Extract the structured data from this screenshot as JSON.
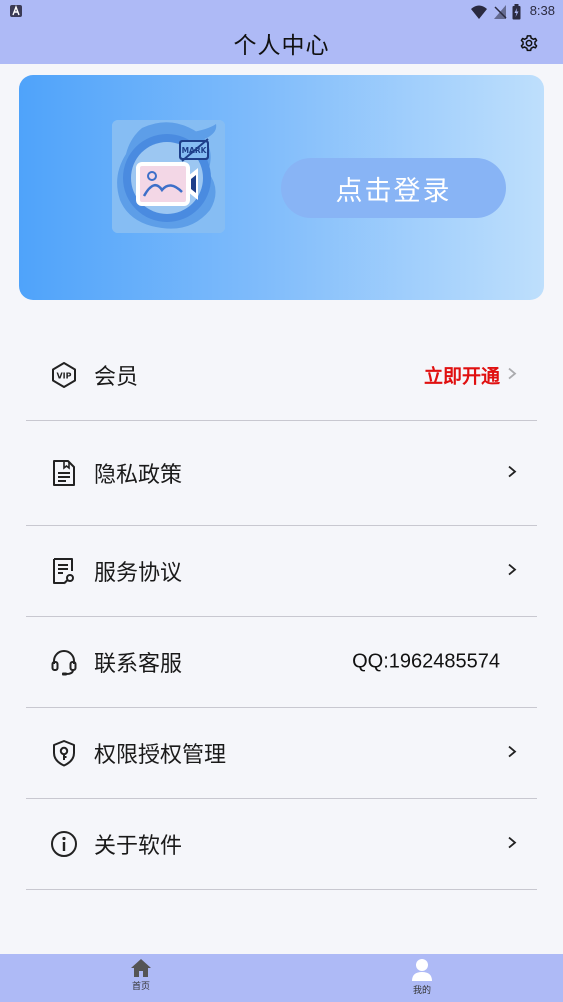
{
  "status_bar": {
    "time": "8:38"
  },
  "header": {
    "title": "个人中心",
    "settings_icon": "gear-icon"
  },
  "banner": {
    "login_label": "点击登录",
    "logo_badge_text": "MARK",
    "colors": {
      "gradient_start": "#4fa3fa",
      "gradient_end": "#bedffc",
      "button": "#88b4f5"
    }
  },
  "menu": {
    "vip": {
      "label": "会员",
      "value": "立即开通",
      "icon": "vip-icon",
      "value_color": "#e01010"
    },
    "privacy": {
      "label": "隐私政策",
      "icon": "document-icon"
    },
    "service": {
      "label": "服务协议",
      "icon": "agreement-icon"
    },
    "contact": {
      "label": "联系客服",
      "value": "QQ:1962485574",
      "icon": "headset-icon"
    },
    "permissions": {
      "label": "权限授权管理",
      "icon": "shield-key-icon"
    },
    "about": {
      "label": "关于软件",
      "icon": "info-icon"
    }
  },
  "bottom_nav": {
    "home": {
      "label": "首页",
      "icon": "home-icon"
    },
    "mine": {
      "label": "我的",
      "icon": "person-icon",
      "active": true
    }
  },
  "colors": {
    "header_bg": "#aebaf6",
    "page_bg": "#f5f6fa"
  }
}
